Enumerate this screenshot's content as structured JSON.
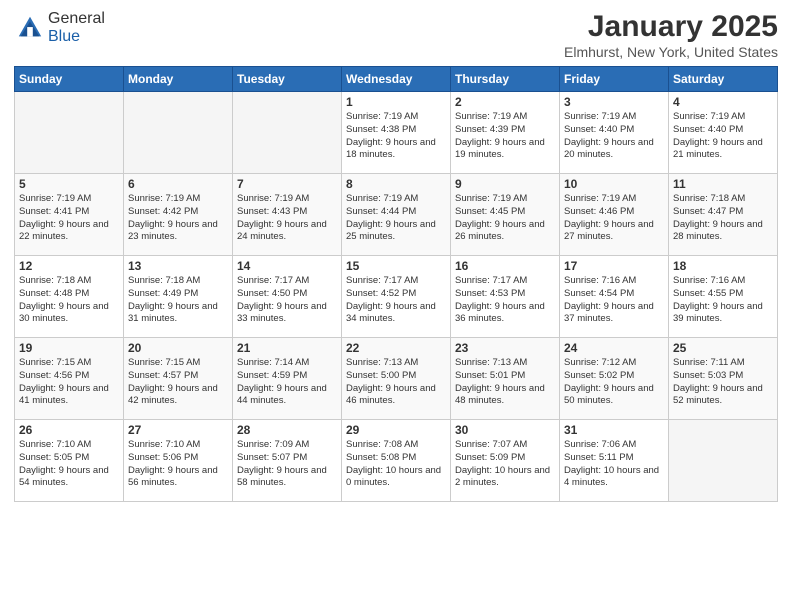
{
  "header": {
    "logo_general": "General",
    "logo_blue": "Blue",
    "month_title": "January 2025",
    "location": "Elmhurst, New York, United States"
  },
  "days_of_week": [
    "Sunday",
    "Monday",
    "Tuesday",
    "Wednesday",
    "Thursday",
    "Friday",
    "Saturday"
  ],
  "weeks": [
    [
      {
        "day": "",
        "empty": true
      },
      {
        "day": "",
        "empty": true
      },
      {
        "day": "",
        "empty": true
      },
      {
        "day": "1",
        "sunrise": "7:19 AM",
        "sunset": "4:38 PM",
        "daylight": "9 hours and 18 minutes."
      },
      {
        "day": "2",
        "sunrise": "7:19 AM",
        "sunset": "4:39 PM",
        "daylight": "9 hours and 19 minutes."
      },
      {
        "day": "3",
        "sunrise": "7:19 AM",
        "sunset": "4:40 PM",
        "daylight": "9 hours and 20 minutes."
      },
      {
        "day": "4",
        "sunrise": "7:19 AM",
        "sunset": "4:40 PM",
        "daylight": "9 hours and 21 minutes."
      }
    ],
    [
      {
        "day": "5",
        "sunrise": "7:19 AM",
        "sunset": "4:41 PM",
        "daylight": "9 hours and 22 minutes."
      },
      {
        "day": "6",
        "sunrise": "7:19 AM",
        "sunset": "4:42 PM",
        "daylight": "9 hours and 23 minutes."
      },
      {
        "day": "7",
        "sunrise": "7:19 AM",
        "sunset": "4:43 PM",
        "daylight": "9 hours and 24 minutes."
      },
      {
        "day": "8",
        "sunrise": "7:19 AM",
        "sunset": "4:44 PM",
        "daylight": "9 hours and 25 minutes."
      },
      {
        "day": "9",
        "sunrise": "7:19 AM",
        "sunset": "4:45 PM",
        "daylight": "9 hours and 26 minutes."
      },
      {
        "day": "10",
        "sunrise": "7:19 AM",
        "sunset": "4:46 PM",
        "daylight": "9 hours and 27 minutes."
      },
      {
        "day": "11",
        "sunrise": "7:18 AM",
        "sunset": "4:47 PM",
        "daylight": "9 hours and 28 minutes."
      }
    ],
    [
      {
        "day": "12",
        "sunrise": "7:18 AM",
        "sunset": "4:48 PM",
        "daylight": "9 hours and 30 minutes."
      },
      {
        "day": "13",
        "sunrise": "7:18 AM",
        "sunset": "4:49 PM",
        "daylight": "9 hours and 31 minutes."
      },
      {
        "day": "14",
        "sunrise": "7:17 AM",
        "sunset": "4:50 PM",
        "daylight": "9 hours and 33 minutes."
      },
      {
        "day": "15",
        "sunrise": "7:17 AM",
        "sunset": "4:52 PM",
        "daylight": "9 hours and 34 minutes."
      },
      {
        "day": "16",
        "sunrise": "7:17 AM",
        "sunset": "4:53 PM",
        "daylight": "9 hours and 36 minutes."
      },
      {
        "day": "17",
        "sunrise": "7:16 AM",
        "sunset": "4:54 PM",
        "daylight": "9 hours and 37 minutes."
      },
      {
        "day": "18",
        "sunrise": "7:16 AM",
        "sunset": "4:55 PM",
        "daylight": "9 hours and 39 minutes."
      }
    ],
    [
      {
        "day": "19",
        "sunrise": "7:15 AM",
        "sunset": "4:56 PM",
        "daylight": "9 hours and 41 minutes."
      },
      {
        "day": "20",
        "sunrise": "7:15 AM",
        "sunset": "4:57 PM",
        "daylight": "9 hours and 42 minutes."
      },
      {
        "day": "21",
        "sunrise": "7:14 AM",
        "sunset": "4:59 PM",
        "daylight": "9 hours and 44 minutes."
      },
      {
        "day": "22",
        "sunrise": "7:13 AM",
        "sunset": "5:00 PM",
        "daylight": "9 hours and 46 minutes."
      },
      {
        "day": "23",
        "sunrise": "7:13 AM",
        "sunset": "5:01 PM",
        "daylight": "9 hours and 48 minutes."
      },
      {
        "day": "24",
        "sunrise": "7:12 AM",
        "sunset": "5:02 PM",
        "daylight": "9 hours and 50 minutes."
      },
      {
        "day": "25",
        "sunrise": "7:11 AM",
        "sunset": "5:03 PM",
        "daylight": "9 hours and 52 minutes."
      }
    ],
    [
      {
        "day": "26",
        "sunrise": "7:10 AM",
        "sunset": "5:05 PM",
        "daylight": "9 hours and 54 minutes."
      },
      {
        "day": "27",
        "sunrise": "7:10 AM",
        "sunset": "5:06 PM",
        "daylight": "9 hours and 56 minutes."
      },
      {
        "day": "28",
        "sunrise": "7:09 AM",
        "sunset": "5:07 PM",
        "daylight": "9 hours and 58 minutes."
      },
      {
        "day": "29",
        "sunrise": "7:08 AM",
        "sunset": "5:08 PM",
        "daylight": "10 hours and 0 minutes."
      },
      {
        "day": "30",
        "sunrise": "7:07 AM",
        "sunset": "5:09 PM",
        "daylight": "10 hours and 2 minutes."
      },
      {
        "day": "31",
        "sunrise": "7:06 AM",
        "sunset": "5:11 PM",
        "daylight": "10 hours and 4 minutes."
      },
      {
        "day": "",
        "empty": true
      }
    ]
  ],
  "labels": {
    "sunrise": "Sunrise:",
    "sunset": "Sunset:",
    "daylight": "Daylight:"
  }
}
